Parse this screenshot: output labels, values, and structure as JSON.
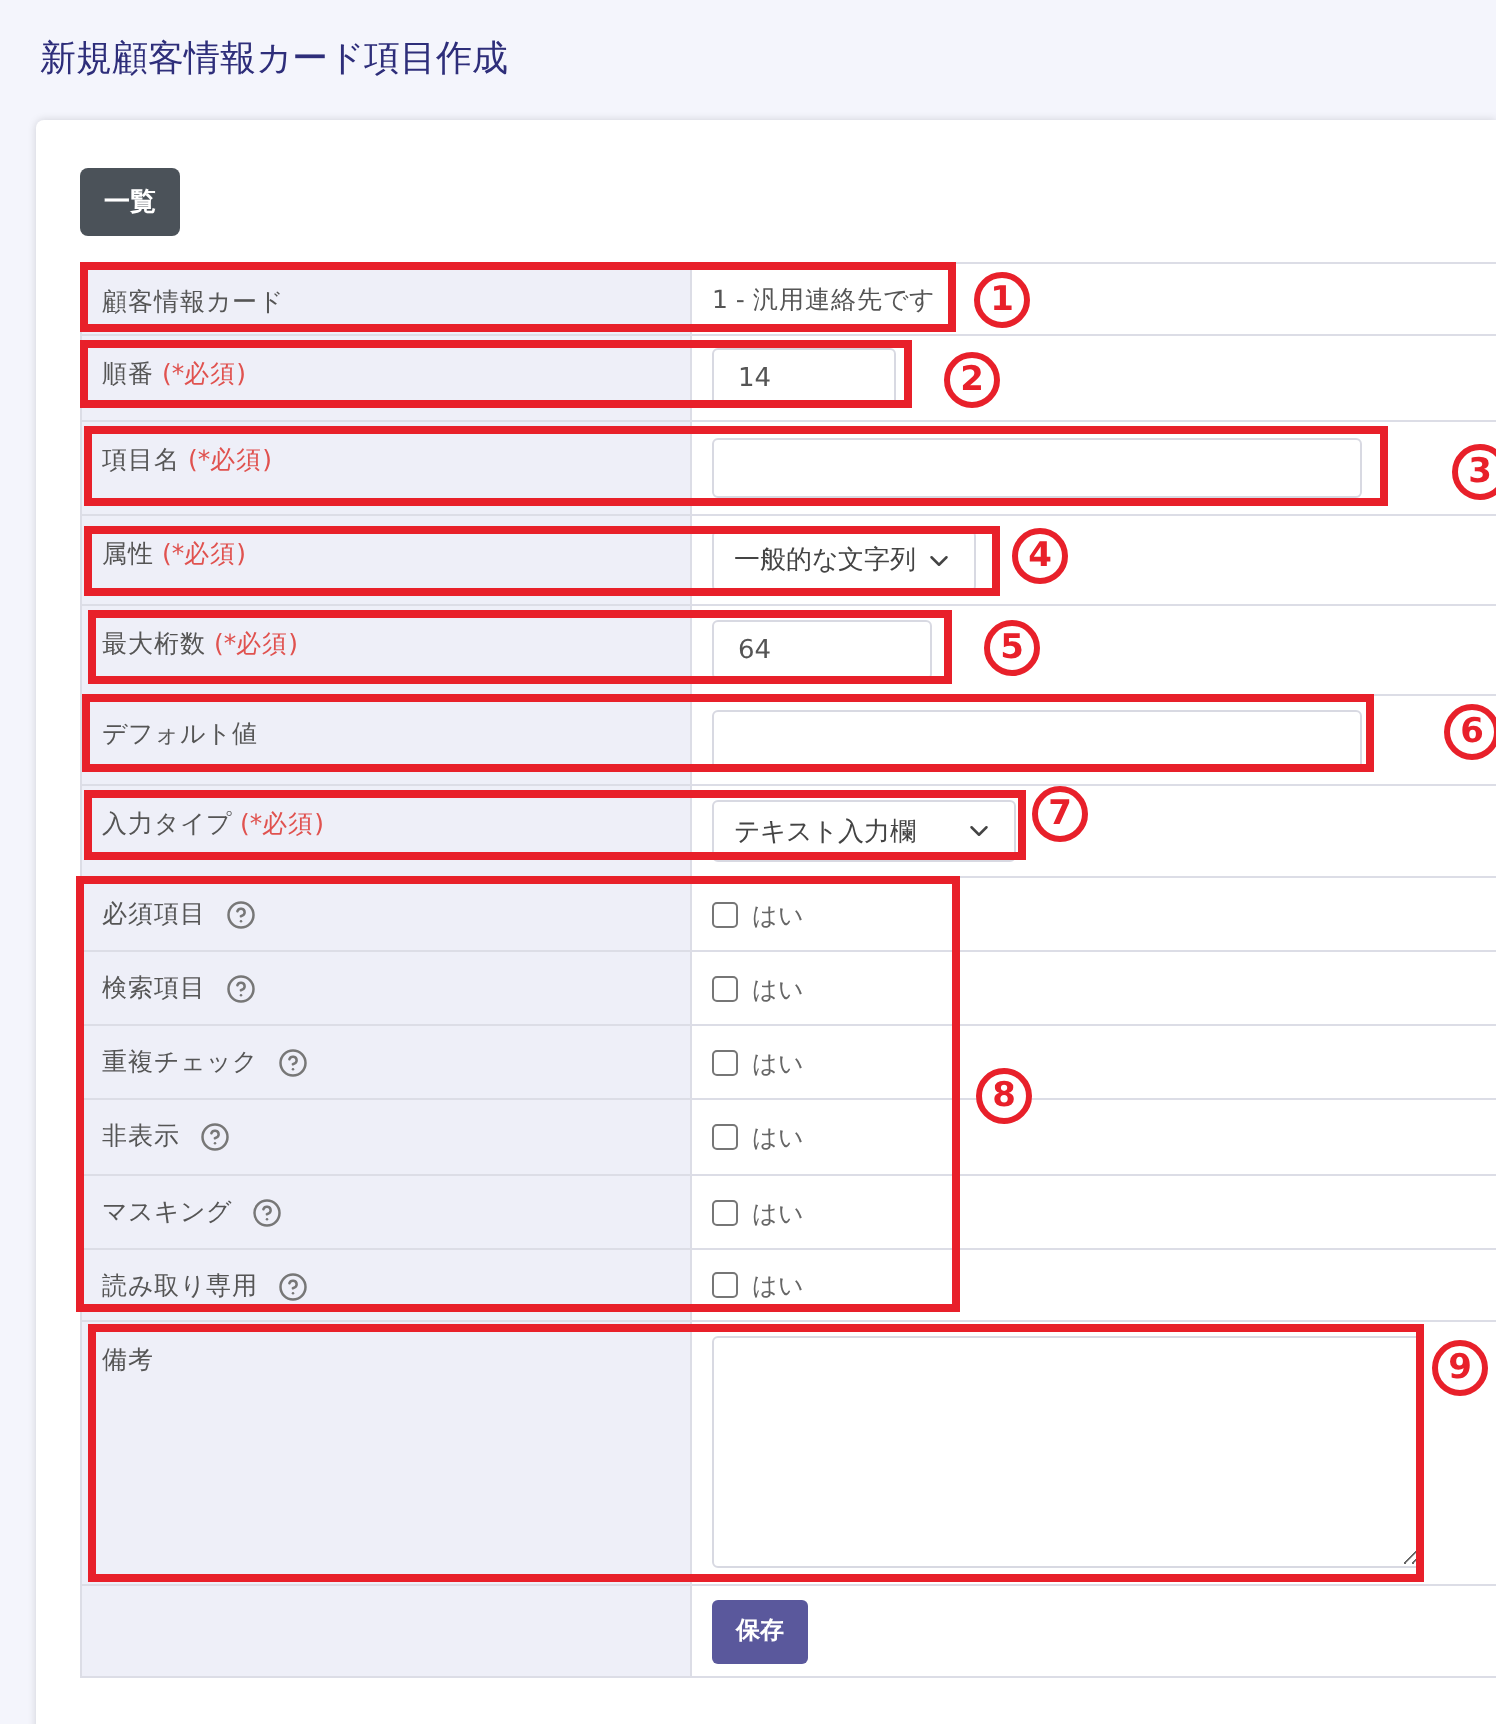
{
  "page_title": "新規顧客情報カード項目作成",
  "list_button": "一覧",
  "rows": [
    {
      "kind": "text",
      "label": "顧客情報カード",
      "value": "1 - 汎用連絡先です"
    },
    {
      "kind": "input",
      "label": "順番",
      "required_mark": "(*必須)",
      "value": "14"
    },
    {
      "kind": "input",
      "label": "項目名",
      "required_mark": "(*必須)"
    },
    {
      "kind": "select",
      "label": "属性",
      "required_mark": "(*必須)",
      "value": "一般的な文字列"
    },
    {
      "kind": "input",
      "label": "最大桁数",
      "required_mark": "(*必須)",
      "value": "64"
    },
    {
      "kind": "input",
      "label": "デフォルト値"
    },
    {
      "kind": "select",
      "label": "入力タイプ",
      "required_mark": "(*必須)",
      "value": "テキスト入力欄"
    },
    {
      "kind": "checkbox",
      "label": "必須項目",
      "option": "はい",
      "checked": false
    },
    {
      "kind": "checkbox",
      "label": "検索項目",
      "option": "はい",
      "checked": false
    },
    {
      "kind": "checkbox",
      "label": "重複チェック",
      "option": "はい",
      "checked": false
    },
    {
      "kind": "checkbox",
      "label": "非表示",
      "option": "はい",
      "checked": false
    },
    {
      "kind": "checkbox",
      "label": "マスキング",
      "option": "はい",
      "checked": false
    },
    {
      "kind": "checkbox",
      "label": "読み取り専用",
      "option": "はい",
      "checked": false
    },
    {
      "kind": "textarea",
      "label": "備考"
    },
    {
      "kind": "submit",
      "button": "保存"
    }
  ],
  "annotations": [
    {
      "number": "1"
    },
    {
      "number": "2"
    },
    {
      "number": "3"
    },
    {
      "number": "4"
    },
    {
      "number": "5"
    },
    {
      "number": "6"
    },
    {
      "number": "7"
    },
    {
      "number": "8"
    },
    {
      "number": "9"
    }
  ]
}
